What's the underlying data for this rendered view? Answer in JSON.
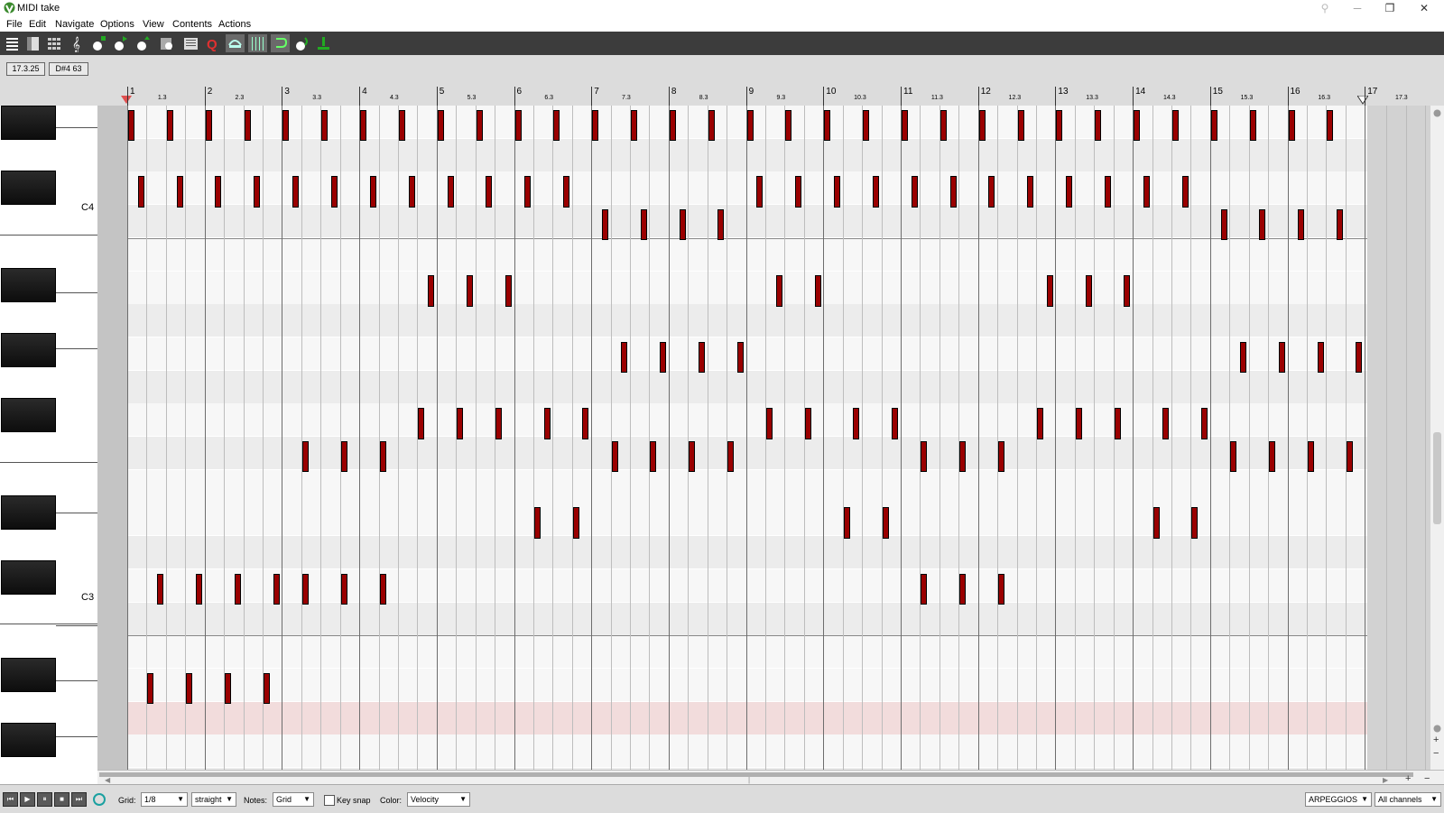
{
  "window": {
    "title": "MIDI take",
    "minimize_glyph": "─",
    "restore_glyph": "❐",
    "close_glyph": "✕",
    "pin_glyph": "⚲"
  },
  "menu": [
    "File",
    "Edit",
    "Navigate",
    "Options",
    "View",
    "Contents",
    "Actions"
  ],
  "toolbar_icons": [
    "mode-piano-roll-icon",
    "mode-named-notes-icon",
    "mode-drum-grid-icon",
    "mode-notation-icon",
    "insert-note-icon",
    "play-item-icon",
    "play-pattern-icon",
    "fold-notes-icon",
    "edit-toolbar-icon",
    "event-list-icon",
    "quantize-icon",
    "snap-icon",
    "grid-icon",
    "loop-icon",
    "midi-input-icon",
    "step-input-icon"
  ],
  "info": {
    "position": "17.3.25",
    "note": "D#4  63"
  },
  "ruler": {
    "bars": [
      "1",
      "2",
      "3",
      "4",
      "5",
      "6",
      "7",
      "8",
      "9",
      "10",
      "11",
      "12",
      "13",
      "14",
      "15",
      "16",
      "17"
    ],
    "beats": [
      "1.3",
      "2.3",
      "3.3",
      "4.3",
      "5.3",
      "6.3",
      "7.3",
      "8.3",
      "9.3",
      "10.3",
      "11.3",
      "12.3",
      "13.3",
      "14.3",
      "15.3",
      "16.3",
      "17.3"
    ]
  },
  "keyboard": {
    "c4_label": "C4",
    "c3_label": "C3"
  },
  "roll": {
    "note_color": "#9a0000",
    "beat_fraction_per_bar": 4,
    "rows": [
      {
        "row": 1,
        "starts": [
          1.0,
          1.5,
          2.0,
          2.5,
          3.0,
          3.5,
          4.0,
          4.5,
          5.0,
          5.5,
          6.0,
          6.5,
          7.0,
          7.5,
          8.0,
          8.5,
          9.0,
          9.5,
          10.0,
          10.5,
          11.0,
          11.5,
          12.0,
          12.5,
          13.0,
          13.5,
          14.0,
          14.5,
          15.0,
          15.5,
          16.0,
          16.5
        ]
      },
      {
        "row": 3,
        "starts": [
          1.125,
          1.625,
          2.125,
          2.625,
          3.125,
          3.625,
          4.125,
          4.625,
          5.125,
          5.625,
          6.125,
          6.625,
          9.125,
          9.625,
          10.125,
          10.625,
          11.125,
          11.625,
          12.125,
          12.625,
          13.125,
          13.625,
          14.125,
          14.625
        ]
      },
      {
        "row": 4,
        "starts": [
          7.125,
          7.625,
          8.125,
          8.625,
          15.125,
          15.625,
          16.125,
          16.625
        ]
      },
      {
        "row": 6,
        "starts": [
          4.875,
          5.375,
          5.875,
          9.375,
          9.875,
          12.875,
          13.375,
          13.875
        ]
      },
      {
        "row": 8,
        "starts": [
          7.375,
          7.875,
          8.375,
          8.875,
          15.375,
          15.875,
          16.375,
          16.875
        ]
      },
      {
        "row": 10,
        "starts": [
          4.75,
          5.25,
          5.75,
          6.375,
          6.875,
          9.25,
          9.75,
          10.375,
          10.875,
          12.75,
          13.25,
          13.75,
          14.375,
          14.875
        ]
      },
      {
        "row": 11,
        "starts": [
          3.25,
          3.75,
          4.25,
          7.25,
          7.75,
          8.25,
          8.75,
          11.25,
          11.75,
          12.25,
          15.25,
          15.75,
          16.25,
          16.75
        ]
      },
      {
        "row": 13,
        "starts": [
          6.25,
          6.75,
          10.25,
          10.75,
          14.25,
          14.75
        ]
      },
      {
        "row": 15,
        "starts": [
          1.375,
          1.875,
          2.375,
          2.875,
          3.25,
          3.75,
          4.25,
          11.25,
          11.75,
          12.25
        ]
      },
      {
        "row": 18,
        "starts": [
          1.25,
          1.75,
          2.25,
          2.75
        ]
      }
    ],
    "note_length_beats": 0.1
  },
  "bottom": {
    "grid_label": "Grid:",
    "grid_value": "1/8",
    "swing_value": "straight",
    "notes_label": "Notes:",
    "notes_value": "Grid",
    "keysnap_label": "Key snap",
    "color_label": "Color:",
    "color_value": "Velocity",
    "keyset_value": "ARPEGGIOS",
    "channel_value": "All channels"
  }
}
